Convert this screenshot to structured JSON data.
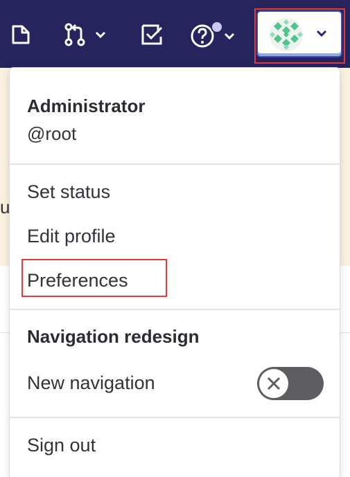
{
  "topbar": {
    "icons": [
      "document-icon",
      "merge-request-icon",
      "todo-check-icon",
      "help-icon"
    ]
  },
  "user": {
    "name": "Administrator",
    "username": "@root"
  },
  "menu": {
    "set_status": "Set status",
    "edit_profile": "Edit profile",
    "preferences": "Preferences",
    "nav_heading": "Navigation redesign",
    "new_navigation": "New navigation",
    "new_navigation_enabled": false,
    "sign_out": "Sign out"
  },
  "background": {
    "partial_letter": "u"
  },
  "colors": {
    "topbar": "#25245c",
    "highlight": "#e23a3a",
    "banner": "#fbf1e1",
    "toggle_off": "#5e5d62"
  }
}
